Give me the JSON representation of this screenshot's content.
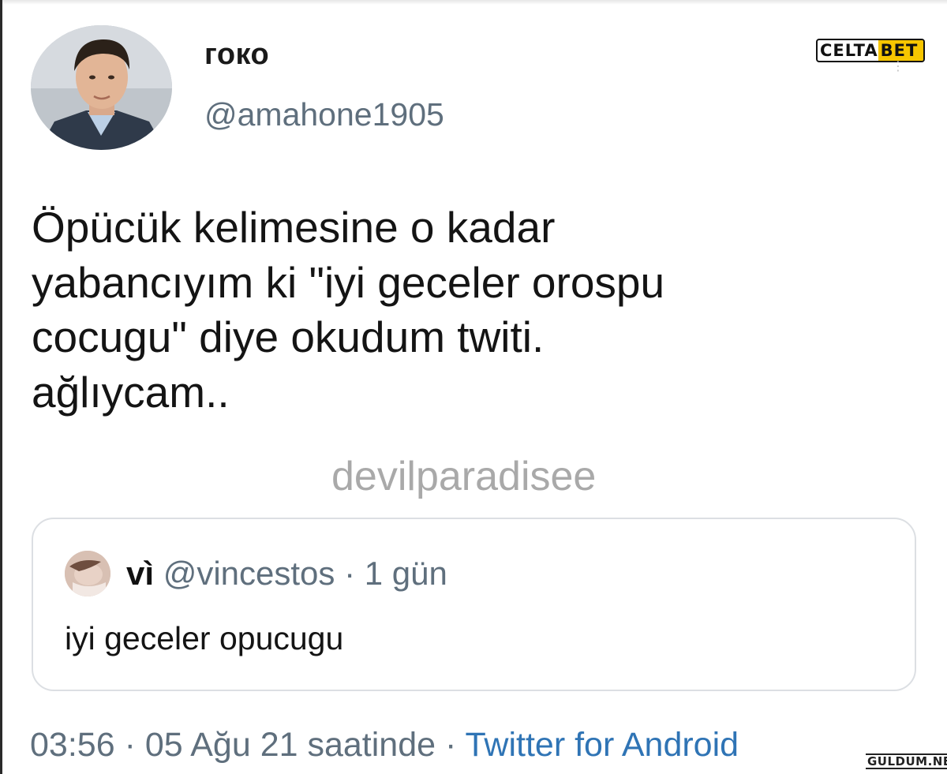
{
  "tweet": {
    "author": {
      "display_name": "гоко",
      "handle": "@amahone1905"
    },
    "text_lines": [
      "Öpücük kelimesine o kadar",
      "yabancıyım ki  \"iyi geceler orospu",
      "cocugu\" diye okudum twiti.",
      "ağlıycam.."
    ],
    "watermark": "devilparadisee",
    "quoted": {
      "display_name": "vì",
      "handle": "@vincestos",
      "separator": "·",
      "age": "1 gün",
      "text": "iyi geceler opucugu"
    },
    "footer": {
      "time": "03:56",
      "separator1": "·",
      "date_phrase": "05 Ağu 21 saatinde",
      "separator2": "·",
      "client": "Twitter for Android"
    }
  },
  "overlays": {
    "brand_badge_part1": "CELTA",
    "brand_badge_part2": "BET",
    "site_badge": "GULDUM.NET"
  },
  "icons": {
    "more": "more-vertical-icon"
  },
  "colors": {
    "link_blue": "#2f74b5",
    "secondary_gray": "#5f6f7d",
    "watermark_gray": "#a9a9a9",
    "card_border": "#dcdfe3",
    "badge_yellow": "#f7c600"
  }
}
